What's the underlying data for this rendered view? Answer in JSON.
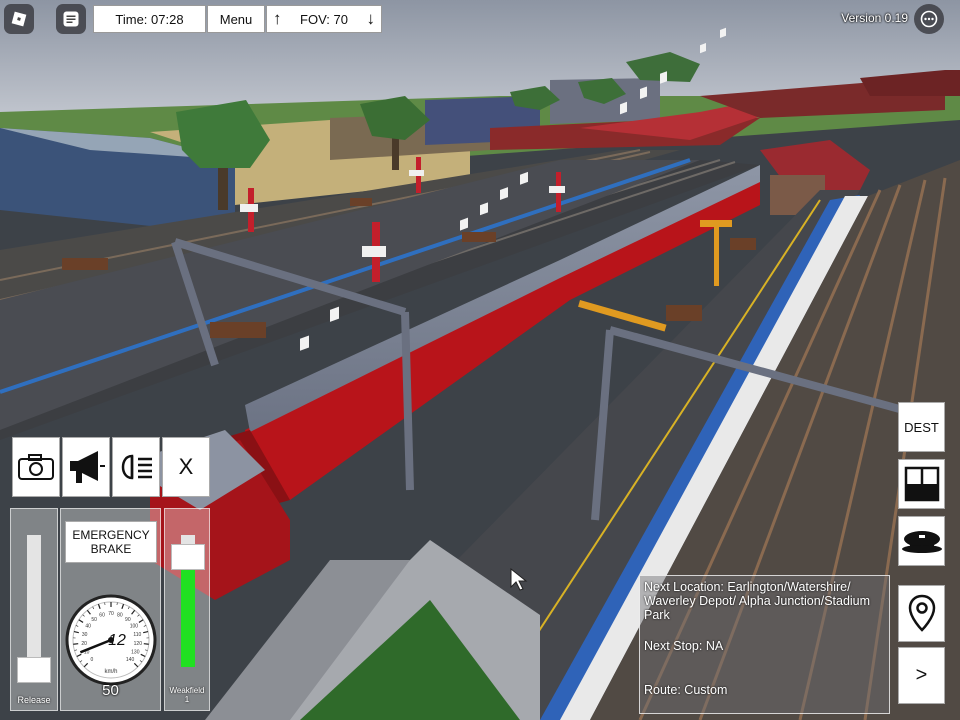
{
  "topbar": {
    "time": "Time: 07:28",
    "menu": "Menu",
    "fov": "FOV: 70",
    "fov_up_icon": "arrow-up-icon",
    "fov_down_icon": "arrow-down-icon",
    "version": "Version 0.19"
  },
  "controls": {
    "buttons": [
      {
        "name": "camera-icon"
      },
      {
        "name": "horn-icon"
      },
      {
        "name": "headlight-icon"
      },
      {
        "name": "close",
        "label": "X"
      }
    ],
    "release_label": "Release",
    "release_level": 0.0,
    "emergency_brake": "EMERGENCY BRAKE",
    "speed": "12",
    "speed_unit": "km/h",
    "speed_limit": "50",
    "gauge_ticks": [
      "0",
      "10",
      "20",
      "30",
      "40",
      "50",
      "60",
      "70",
      "80",
      "90",
      "100",
      "110",
      "120",
      "130",
      "140"
    ],
    "weakfield_label": "Weakfield",
    "weakfield_value": "1",
    "weakfield_level": 0.83
  },
  "right_buttons": {
    "dest": "DEST",
    "split_icon": "split-screen-icon",
    "cap_icon": "driver-cap-icon",
    "pin_icon": "location-pin-icon",
    "next": ">"
  },
  "info": {
    "next_location": "Next Location: Earlington/Watershire/ Waverley Depot/ Alpha Junction/Stadium Park",
    "next_stop": "Next Stop: NA",
    "route": "Route: Custom"
  },
  "colors": {
    "train_red": "#b8141a",
    "platform_yellow_line": "#e0b020",
    "weakfield_green": "#21e021"
  }
}
